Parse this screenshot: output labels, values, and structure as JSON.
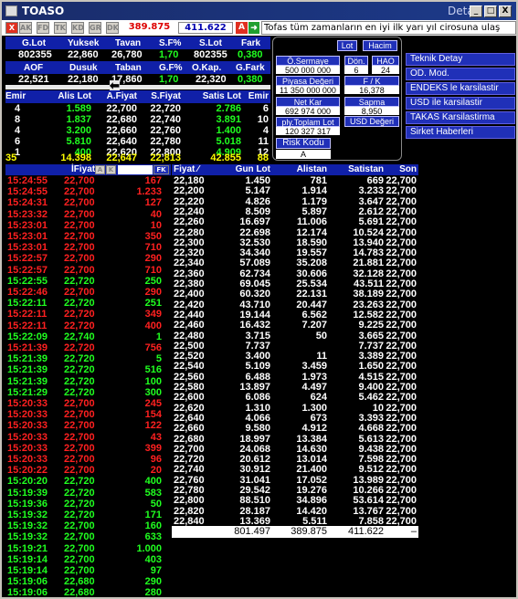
{
  "window": {
    "title": "TOASO",
    "detail_label": "Detay",
    "min": "_",
    "max": "□",
    "close": "X"
  },
  "toolbar": {
    "buttons": [
      "X",
      "AK",
      "FD",
      "TK",
      "KD",
      "GR",
      "DK"
    ],
    "price_red": "389.875",
    "price_blue": "411.622",
    "a_btn": "A",
    "arrow_btn": "➜",
    "news": "Tofas tüm zamanların en iyi ilk yarı yıl cirosuna ulaş"
  },
  "summary": {
    "headers1": [
      "G.Lot",
      "Yuksek",
      "Tavan",
      "S.F%",
      "S.Lot",
      "Fark"
    ],
    "values1": [
      "802355",
      "22,860",
      "26,780",
      "1,70",
      "802355",
      "0,380"
    ],
    "headers2": [
      "AOF",
      "Dusuk",
      "Taban",
      "G.F%",
      "O.Kap.",
      "G.Fark"
    ],
    "values2": [
      "22,521",
      "22,180",
      "17,860",
      "1,70",
      "22,320",
      "0,380"
    ]
  },
  "panel": {
    "lot": "Lot",
    "hacim": "Hacim",
    "o_sermaye": "Ö.Sermaye",
    "o_sermaye_val": "500 000 000",
    "don": "Dön.",
    "don_val": "6",
    "hao": "HAO",
    "hao_val": "24",
    "piyasa": "Piyasa Değeri",
    "piyasa_val": "11 350 000 000",
    "fk": "F / K",
    "fk_val": "16,378",
    "net_kar": "Net Kar",
    "net_kar_val": "692 974 000",
    "sapma": "Sapma",
    "sapma_val": "8,950",
    "ply_toplam": "ply.Toplam Lot",
    "ply_val": "120 327 317",
    "usd": "USD Değeri",
    "risk": "Risk Kodu",
    "risk_val": "A"
  },
  "right_menu": [
    "Teknik Detay",
    "OD. Mod.",
    "ENDEKS le karsilastir",
    "USD ile karsilastir",
    "TAKAS Karsilastirma",
    "Sirket Haberleri"
  ],
  "orders": {
    "headers": [
      "Emir",
      "Alis Lot",
      "A.Fiyat",
      "S.Fiyat",
      "Satis Lot",
      "Emir"
    ],
    "rows": [
      [
        "4",
        "1.589",
        "22,700",
        "22,720",
        "2.786",
        "6"
      ],
      [
        "8",
        "1.837",
        "22,680",
        "22,740",
        "3.891",
        "10"
      ],
      [
        "4",
        "3.200",
        "22,660",
        "22,760",
        "1.400",
        "4"
      ],
      [
        "6",
        "5.810",
        "22,640",
        "22,780",
        "5.018",
        "11"
      ],
      [
        "1",
        "400",
        "22,620",
        "22,800",
        "4.909",
        "12"
      ]
    ],
    "total": [
      "35",
      "14.398",
      "22,647",
      "22,813",
      "42.855",
      "88"
    ]
  },
  "trades": {
    "header_fiyat": "İFiyat",
    "btn_a": "A",
    "btn_k": "K",
    "btn_fk": "FK",
    "rows": [
      [
        "15:24:55",
        "22,700",
        "167",
        "r"
      ],
      [
        "15:24:55",
        "22,700",
        "1.233",
        "r"
      ],
      [
        "15:24:31",
        "22,700",
        "127",
        "r"
      ],
      [
        "15:23:32",
        "22,700",
        "40",
        "r"
      ],
      [
        "15:23:01",
        "22,700",
        "10",
        "r"
      ],
      [
        "15:23:01",
        "22,700",
        "350",
        "r"
      ],
      [
        "15:23:01",
        "22,700",
        "710",
        "r"
      ],
      [
        "15:22:57",
        "22,700",
        "290",
        "r"
      ],
      [
        "15:22:57",
        "22,700",
        "710",
        "r"
      ],
      [
        "15:22:55",
        "22,720",
        "250",
        "g"
      ],
      [
        "15:22:46",
        "22,700",
        "290",
        "r"
      ],
      [
        "15:22:11",
        "22,720",
        "251",
        "g"
      ],
      [
        "15:22:11",
        "22,720",
        "349",
        "r"
      ],
      [
        "15:22:11",
        "22,720",
        "400",
        "r"
      ],
      [
        "15:22:09",
        "22,740",
        "1",
        "g"
      ],
      [
        "15:21:39",
        "22,720",
        "756",
        "r"
      ],
      [
        "15:21:39",
        "22,720",
        "5",
        "g"
      ],
      [
        "15:21:39",
        "22,720",
        "516",
        "g"
      ],
      [
        "15:21:39",
        "22,720",
        "100",
        "g"
      ],
      [
        "15:21:29",
        "22,720",
        "300",
        "g"
      ],
      [
        "15:20:33",
        "22,700",
        "245",
        "r"
      ],
      [
        "15:20:33",
        "22,700",
        "154",
        "r"
      ],
      [
        "15:20:33",
        "22,700",
        "122",
        "r"
      ],
      [
        "15:20:33",
        "22,700",
        "43",
        "r"
      ],
      [
        "15:20:33",
        "22,700",
        "399",
        "r"
      ],
      [
        "15:20:33",
        "22,700",
        "96",
        "r"
      ],
      [
        "15:20:22",
        "22,700",
        "20",
        "r"
      ],
      [
        "15:20:20",
        "22,720",
        "400",
        "g"
      ],
      [
        "15:19:39",
        "22,720",
        "583",
        "g"
      ],
      [
        "15:19:36",
        "22,720",
        "50",
        "g"
      ],
      [
        "15:19:32",
        "22,720",
        "171",
        "g"
      ],
      [
        "15:19:32",
        "22,700",
        "160",
        "g"
      ],
      [
        "15:19:32",
        "22,700",
        "633",
        "g"
      ],
      [
        "15:19:21",
        "22,700",
        "1.000",
        "g"
      ],
      [
        "15:19:14",
        "22,700",
        "403",
        "g"
      ],
      [
        "15:19:14",
        "22,700",
        "97",
        "g"
      ],
      [
        "15:19:06",
        "22,680",
        "290",
        "g"
      ],
      [
        "15:19:06",
        "22,680",
        "280",
        "g"
      ]
    ]
  },
  "depth": {
    "headers": [
      "Fiyat",
      "Gun Lot",
      "Alistan",
      "Satistan",
      "Son"
    ],
    "rows": [
      [
        "22,180",
        "1.450",
        "781",
        "669",
        "22,700"
      ],
      [
        "22,200",
        "5.147",
        "1.914",
        "3.233",
        "22,700"
      ],
      [
        "22,220",
        "4.826",
        "1.179",
        "3.647",
        "22,700"
      ],
      [
        "22,240",
        "8.509",
        "5.897",
        "2.612",
        "22,700"
      ],
      [
        "22,260",
        "16.697",
        "11.006",
        "5.691",
        "22,700"
      ],
      [
        "22,280",
        "22.698",
        "12.174",
        "10.524",
        "22,700"
      ],
      [
        "22,300",
        "32.530",
        "18.590",
        "13.940",
        "22,700"
      ],
      [
        "22,320",
        "34.340",
        "19.557",
        "14.783",
        "22,700"
      ],
      [
        "22,340",
        "57.089",
        "35.208",
        "21.881",
        "22,700"
      ],
      [
        "22,360",
        "62.734",
        "30.606",
        "32.128",
        "22,700"
      ],
      [
        "22,380",
        "69.045",
        "25.534",
        "43.511",
        "22,700"
      ],
      [
        "22,400",
        "60.320",
        "22.131",
        "38.189",
        "22,700"
      ],
      [
        "22,420",
        "43.710",
        "20.447",
        "23.263",
        "22,700"
      ],
      [
        "22,440",
        "19.144",
        "6.562",
        "12.582",
        "22,700"
      ],
      [
        "22,460",
        "16.432",
        "7.207",
        "9.225",
        "22,700"
      ],
      [
        "22,480",
        "3.715",
        "50",
        "3.665",
        "22,700"
      ],
      [
        "22,500",
        "7.737",
        "",
        "7.737",
        "22,700"
      ],
      [
        "22,520",
        "3.400",
        "11",
        "3.389",
        "22,700"
      ],
      [
        "22,540",
        "5.109",
        "3.459",
        "1.650",
        "22,700"
      ],
      [
        "22,560",
        "6.488",
        "1.973",
        "4.515",
        "22,700"
      ],
      [
        "22,580",
        "13.897",
        "4.497",
        "9.400",
        "22,700"
      ],
      [
        "22,600",
        "6.086",
        "624",
        "5.462",
        "22,700"
      ],
      [
        "22,620",
        "1.310",
        "1.300",
        "10",
        "22,700"
      ],
      [
        "22,640",
        "4.066",
        "673",
        "3.393",
        "22,700"
      ],
      [
        "22,660",
        "9.580",
        "4.912",
        "4.668",
        "22,700"
      ],
      [
        "22,680",
        "18.997",
        "13.384",
        "5.613",
        "22,700"
      ],
      [
        "22,700",
        "24.068",
        "14.630",
        "9.438",
        "22,700"
      ],
      [
        "22,720",
        "20.612",
        "13.014",
        "7.598",
        "22,700"
      ],
      [
        "22,740",
        "30.912",
        "21.400",
        "9.512",
        "22,700"
      ],
      [
        "22,760",
        "31.041",
        "17.052",
        "13.989",
        "22,700"
      ],
      [
        "22,780",
        "29.542",
        "19.276",
        "10.266",
        "22,700"
      ],
      [
        "22,800",
        "88.510",
        "34.896",
        "53.614",
        "22,700"
      ],
      [
        "22,820",
        "28.187",
        "14.420",
        "13.767",
        "22,700"
      ],
      [
        "22,840",
        "13.369",
        "5.511",
        "7.858",
        "22,700"
      ],
      [
        "22,860",
        "200",
        "",
        "200",
        "22,700"
      ]
    ],
    "totals": [
      "801.497",
      "389.875",
      "411.622",
      "–"
    ]
  },
  "colors": {
    "red": "#ff2020",
    "green": "#20ff20",
    "yellow": "#ffff00",
    "blue_bar": "#1020a8"
  }
}
